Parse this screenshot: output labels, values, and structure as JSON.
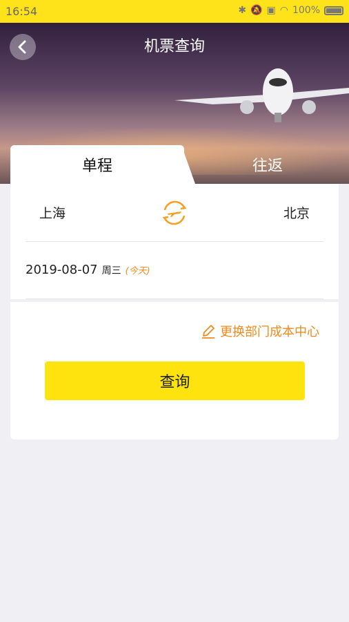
{
  "status_bar": {
    "time": "16:54",
    "battery": "100%"
  },
  "header": {
    "title": "机票查询"
  },
  "tabs": [
    {
      "label": "单程"
    },
    {
      "label": "往返"
    }
  ],
  "route": {
    "from": "上海",
    "to": "北京"
  },
  "date": {
    "value": "2019-08-07",
    "weekday": "周三",
    "note": "(今天)"
  },
  "actions": {
    "change_dept": "更换部门成本中心",
    "query": "查询"
  },
  "colors": {
    "accent": "#ffe30f",
    "orange": "#f08a1c",
    "background": "#efeff4"
  }
}
